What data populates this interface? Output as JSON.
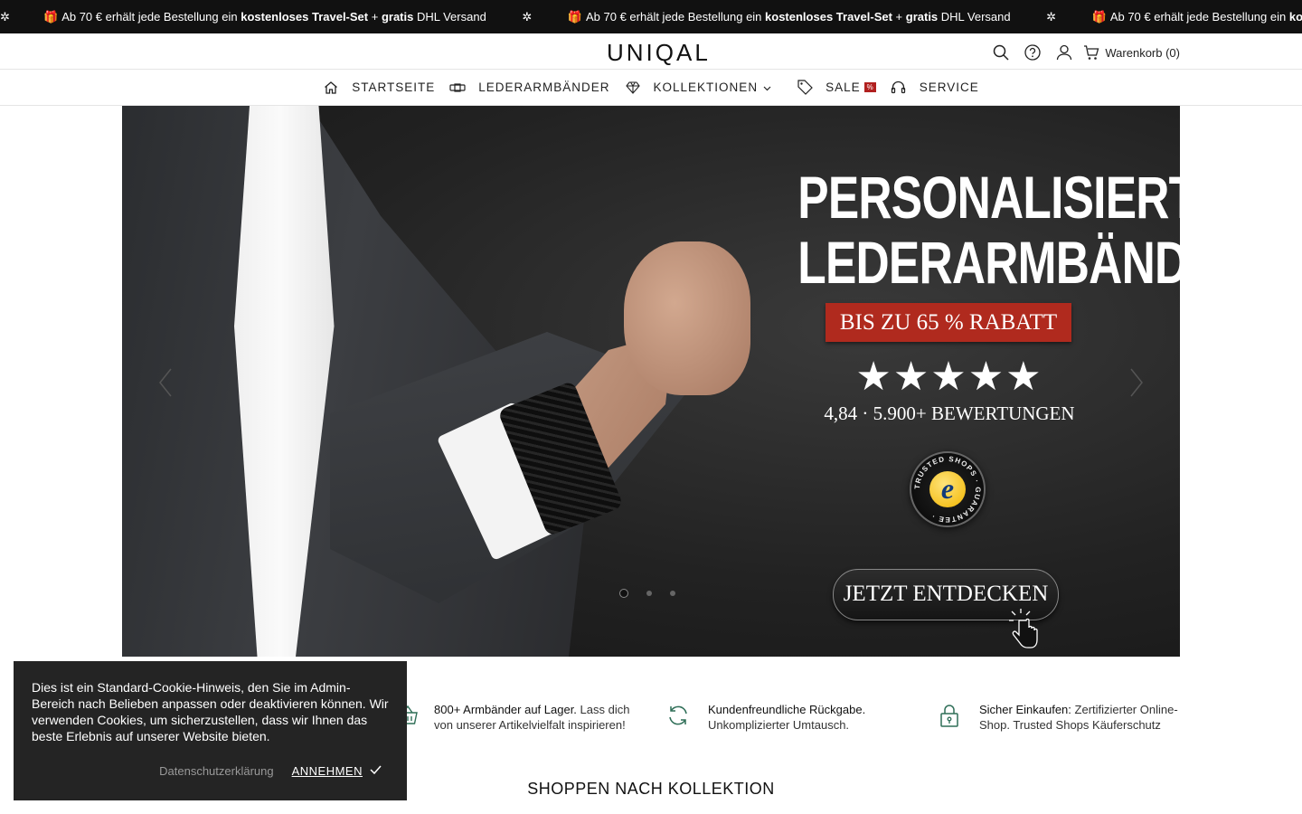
{
  "announcement": {
    "segments": [
      {
        "pre": "Ab 70 € erhält jede Bestellung ein ",
        "b1": "kostenloses Travel-Set",
        "mid": " + ",
        "b2": "gratis",
        "post": " DHL Versand"
      },
      {
        "pre": "Ab 70 € erhält jede Bestellung ein ",
        "b1": "kostenloses Travel-Set",
        "mid": " + ",
        "b2": "gratis",
        "post": " DHL Versand"
      },
      {
        "pre": "Ab 70 € erhält jede Bestellung ein ",
        "b1": "kosten",
        "mid": "",
        "b2": "",
        "post": ""
      }
    ],
    "separator": "✲",
    "gift_glyph": "🎁"
  },
  "header": {
    "logo": "UNIQAL",
    "cart_label": "Warenkorb (0)",
    "icons": [
      "search-icon",
      "help-icon",
      "account-icon",
      "cart-icon"
    ]
  },
  "nav": {
    "items": [
      {
        "label": "STARTSEITE",
        "icon": "home-icon"
      },
      {
        "label": "LEDERARMBÄNDER",
        "icon": "bracelet-icon"
      },
      {
        "label": "KOLLEKTIONEN",
        "icon": "diamond-icon",
        "has_dropdown": true
      },
      {
        "label": "SALE",
        "icon": "tag-icon",
        "badge": "%"
      },
      {
        "label": "SERVICE",
        "icon": "headset-icon"
      }
    ]
  },
  "hero": {
    "headline_line1": "PERSONALISIERTE",
    "headline_line2": "LEDERARMBÄNDER",
    "badge": "BIS ZU 65 % RABATT",
    "stars": "★★★★★",
    "rating_text": "4,84 · 5.900+ BEWERTUNGEN",
    "trusted_letter": "e",
    "trusted_ring_text": "TRUSTED SHOPS · GUARANTEE ·",
    "cta": "JETZT ENTDECKEN",
    "slide_count": 3,
    "active_slide": 1
  },
  "features": [
    {
      "bold": "800+ Armbänder auf Lager.",
      "rest": " Lass dich von unserer Artikelvielfalt inspirieren!",
      "icon": "basket-icon"
    },
    {
      "bold": "Kundenfreundliche Rückgabe.",
      "rest": " Unkomplizierter Umtausch.",
      "icon": "refresh-icon"
    },
    {
      "bold": "Sicher Einkaufen:",
      "rest": " Zertifizierter Online-Shop. Trusted Shops Käuferschutz",
      "icon": "lock-icon"
    }
  ],
  "section_title": "SHOPPEN NACH KOLLEKTION",
  "cookie": {
    "text": "Dies ist ein Standard-Cookie-Hinweis, den Sie im Admin-Bereich nach Belieben anpassen oder deaktivieren können. Wir verwenden Cookies, um sicherzustellen, dass wir Ihnen das beste Erlebnis auf unserer Website bieten.",
    "privacy_label": "Datenschutzerklärung",
    "accept_label": "ANNEHMEN"
  },
  "colors": {
    "topbar_bg": "#111111",
    "sale_badge": "#b1201f",
    "hero_badge": "#b02a1e",
    "feature_icon": "#2e6e57",
    "cookie_bg": "#242424"
  }
}
